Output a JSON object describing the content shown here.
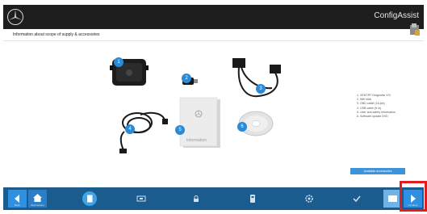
{
  "app": {
    "title": "ConfigAssist"
  },
  "page": {
    "title": "Information about scope of supply & accessories"
  },
  "items": [
    {
      "num": "1"
    },
    {
      "num": "2"
    },
    {
      "num": "3"
    },
    {
      "num": "4"
    },
    {
      "num": "5"
    },
    {
      "num": "6"
    }
  ],
  "info_sheet": {
    "label": "Information"
  },
  "supply_list": [
    "1. XENTRY Diagnosis VCI",
    "2. Wifi stick",
    "3. OBD cable (16-pin)",
    "4. USB cable (5 m)",
    "5. User and safety information",
    "6. Software update DVD"
  ],
  "buttons": {
    "accessories": "Available accessories",
    "back": "Back",
    "start_screen": "Start screen",
    "continue": "Continue"
  },
  "colors": {
    "accent": "#2f8fe0",
    "footer": "#1b5c8f",
    "highlight": "#e31d1d"
  }
}
